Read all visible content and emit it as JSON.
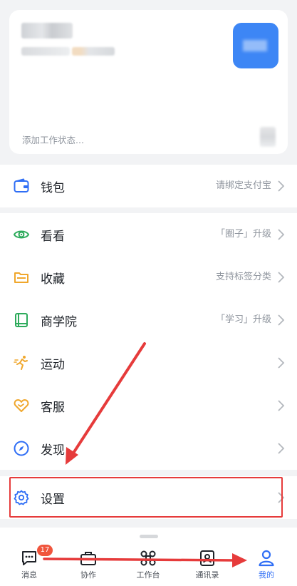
{
  "profile": {
    "status_placeholder": "添加工作状态..."
  },
  "wallet": {
    "label": "钱包",
    "hint": "请绑定支付宝"
  },
  "menu": [
    {
      "key": "kankan",
      "label": "看看",
      "hint": "「圈子」升级"
    },
    {
      "key": "favorites",
      "label": "收藏",
      "hint": "支持标签分类"
    },
    {
      "key": "academy",
      "label": "商学院",
      "hint": "「学习」升级"
    },
    {
      "key": "sports",
      "label": "运动",
      "hint": ""
    },
    {
      "key": "service",
      "label": "客服",
      "hint": ""
    },
    {
      "key": "discover",
      "label": "发现",
      "hint": ""
    }
  ],
  "settings": {
    "label": "设置"
  },
  "tabs": [
    {
      "label": "消息",
      "badge": "17"
    },
    {
      "label": "协作"
    },
    {
      "label": "工作台"
    },
    {
      "label": "通讯录"
    },
    {
      "label": "我的"
    }
  ],
  "colors": {
    "accent": "#2f6ef5",
    "annotation": "#e63b3b",
    "green": "#2eab5c",
    "orange": "#f0a72c",
    "avatar": "#3d86f5"
  }
}
